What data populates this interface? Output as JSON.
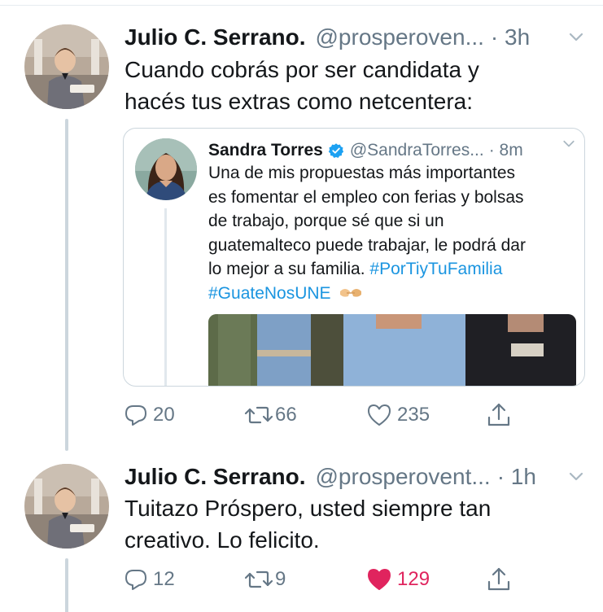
{
  "tweets": [
    {
      "name": "Julio C. Serrano.",
      "handle": "@prosperoven...",
      "time": "· 3h",
      "text_line1": "Cuando cobrás por ser candidata y",
      "text_line2": "hacés tus extras como netcentera:",
      "quote": {
        "name": "Sandra Torres",
        "verified_icon": "verified-badge-icon",
        "handle": "@SandraTorres...",
        "time": "· 8m",
        "text_line1": "Una de mis propuestas más importantes",
        "text_line2": "es fomentar el empleo con ferias y bolsas",
        "text_line3": "de trabajo, porque sé que si un",
        "text_line4": "guatemalteco puede trabajar, le podrá dar",
        "text_line5": "lo mejor a su familia.",
        "hashtag1": "#PorTiyTuFamilia",
        "hashtag2": "#GuateNosUNE",
        "emoji": "handshake-emoji"
      },
      "actions": {
        "replies": "20",
        "retweets": "66",
        "likes": "235",
        "liked": false
      }
    },
    {
      "name": "Julio C. Serrano.",
      "handle": "@prosperovent...",
      "time": "· 1h",
      "text_line1": "Tuitazo Próspero, usted siempre tan",
      "text_line2": "creativo. Lo felicito.",
      "actions": {
        "replies": "12",
        "retweets": "9",
        "likes": "129",
        "liked": true
      }
    }
  ],
  "colors": {
    "text": "#14171a",
    "secondary": "#657786",
    "link": "#1b95e0",
    "like_active": "#e0245e",
    "border": "#ccd6dd"
  }
}
